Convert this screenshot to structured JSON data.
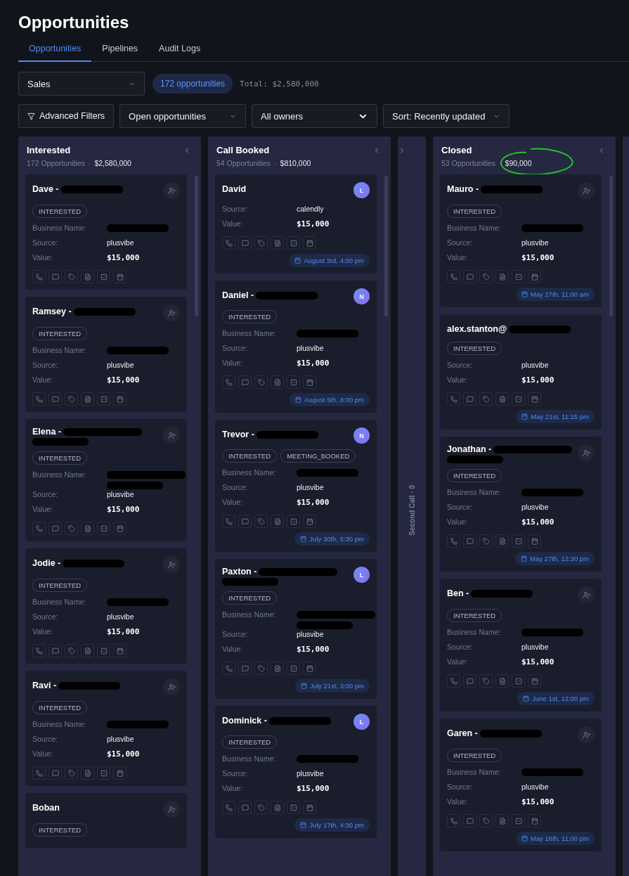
{
  "page": {
    "title": "Opportunities"
  },
  "tabs": [
    {
      "label": "Opportunities",
      "selected": true
    },
    {
      "label": "Pipelines",
      "selected": false
    },
    {
      "label": "Audit Logs",
      "selected": false
    }
  ],
  "toolbar": {
    "pipeline": "Sales",
    "count": "172 opportunities",
    "total": "Total: $2,580,000",
    "filters_button": "Advanced Filters",
    "status_filter": "Open opportunities",
    "owner_filter": "All owners",
    "sort": "Sort: Recently updated"
  },
  "columns": [
    {
      "kind": "expanded",
      "title": "Interested",
      "count": "172 Opportunities",
      "separator": "·",
      "value": "$2,580,000",
      "value_circled": false,
      "cards": [
        {
          "name": "Dave -",
          "redacted": true,
          "redaction_wraps": false,
          "owner": {
            "kind": "unassigned"
          },
          "tags": [
            "INTERESTED"
          ],
          "fields": [
            {
              "label": "Business Name:",
              "kind": "redacted",
              "wraps": false
            },
            {
              "label": "Source:",
              "kind": "text",
              "value": "plusvibe"
            },
            {
              "label": "Value:",
              "kind": "money",
              "value": "$15,000"
            }
          ]
        },
        {
          "name": "Ramsey -",
          "redacted": true,
          "redaction_wraps": false,
          "owner": {
            "kind": "unassigned"
          },
          "tags": [
            "INTERESTED"
          ],
          "fields": [
            {
              "label": "Business Name:",
              "kind": "redacted",
              "wraps": false
            },
            {
              "label": "Source:",
              "kind": "text",
              "value": "plusvibe"
            },
            {
              "label": "Value:",
              "kind": "money",
              "value": "$15,000"
            }
          ]
        },
        {
          "name": "Elena -",
          "redacted": true,
          "redaction_wraps": true,
          "owner": {
            "kind": "unassigned"
          },
          "tags": [
            "INTERESTED"
          ],
          "fields": [
            {
              "label": "Business Name:",
              "kind": "redacted",
              "wraps": true
            },
            {
              "label": "Source:",
              "kind": "text",
              "value": "plusvibe"
            },
            {
              "label": "Value:",
              "kind": "money",
              "value": "$15,000"
            }
          ]
        },
        {
          "name": "Jodie -",
          "redacted": true,
          "redaction_wraps": false,
          "owner": {
            "kind": "unassigned"
          },
          "tags": [
            "INTERESTED"
          ],
          "fields": [
            {
              "label": "Business Name:",
              "kind": "redacted",
              "wraps": false
            },
            {
              "label": "Source:",
              "kind": "text",
              "value": "plusvibe"
            },
            {
              "label": "Value:",
              "kind": "money",
              "value": "$15,000"
            }
          ]
        },
        {
          "name": "Ravi -",
          "redacted": true,
          "redaction_wraps": false,
          "owner": {
            "kind": "unassigned"
          },
          "tags": [
            "INTERESTED"
          ],
          "fields": [
            {
              "label": "Business Name:",
              "kind": "redacted",
              "wraps": false
            },
            {
              "label": "Source:",
              "kind": "text",
              "value": "plusvibe"
            },
            {
              "label": "Value:",
              "kind": "money",
              "value": "$15,000"
            }
          ]
        },
        {
          "name": "Boban",
          "redacted": false,
          "owner": {
            "kind": "unassigned"
          },
          "tags": [
            "INTERESTED"
          ]
        }
      ]
    },
    {
      "kind": "expanded",
      "title": "Call Booked",
      "count": "54 Opportunities",
      "separator": "·",
      "value": "$810,000",
      "value_circled": false,
      "cards": [
        {
          "name": "David",
          "redacted": false,
          "owner": {
            "kind": "avatar",
            "initial": "L"
          },
          "fields": [
            {
              "label": "Source:",
              "kind": "text",
              "value": "calendly"
            },
            {
              "label": "Value:",
              "kind": "money",
              "value": "$15,000"
            }
          ],
          "date": "August 3rd, 4:00 pm"
        },
        {
          "name": "Daniel -",
          "redacted": true,
          "redaction_wraps": false,
          "owner": {
            "kind": "avatar",
            "initial": "N"
          },
          "tags": [
            "INTERESTED"
          ],
          "fields": [
            {
              "label": "Business Name:",
              "kind": "redacted",
              "wraps": false
            },
            {
              "label": "Source:",
              "kind": "text",
              "value": "plusvibe"
            },
            {
              "label": "Value:",
              "kind": "money",
              "value": "$15,000"
            }
          ],
          "date": "August 5th, 8:00 pm"
        },
        {
          "name": "Trevor -",
          "redacted": true,
          "redaction_wraps": false,
          "owner": {
            "kind": "avatar",
            "initial": "N"
          },
          "tags": [
            "INTERESTED",
            "MEETING_BOOKED"
          ],
          "fields": [
            {
              "label": "Business Name:",
              "kind": "redacted",
              "wraps": false
            },
            {
              "label": "Source:",
              "kind": "text",
              "value": "plusvibe"
            },
            {
              "label": "Value:",
              "kind": "money",
              "value": "$15,000"
            }
          ],
          "date": "July 30th, 5:30 pm"
        },
        {
          "name": "Paxton -",
          "redacted": true,
          "redaction_wraps": true,
          "owner": {
            "kind": "avatar",
            "initial": "L"
          },
          "tags": [
            "INTERESTED"
          ],
          "fields": [
            {
              "label": "Business Name:",
              "kind": "redacted",
              "wraps": true
            },
            {
              "label": "Source:",
              "kind": "text",
              "value": "plusvibe"
            },
            {
              "label": "Value:",
              "kind": "money",
              "value": "$15,000"
            }
          ],
          "date": "July 21st, 3:00 pm"
        },
        {
          "name": "Dominick -",
          "redacted": true,
          "redaction_wraps": false,
          "owner": {
            "kind": "avatar",
            "initial": "L"
          },
          "tags": [
            "INTERESTED"
          ],
          "fields": [
            {
              "label": "Business Name:",
              "kind": "redacted",
              "wraps": false
            },
            {
              "label": "Source:",
              "kind": "text",
              "value": "plusvibe"
            },
            {
              "label": "Value:",
              "kind": "money",
              "value": "$15,000"
            }
          ],
          "date": "July 17th, 4:30 pm"
        }
      ]
    },
    {
      "kind": "collapsed",
      "title": "Second Call · 0"
    },
    {
      "kind": "expanded",
      "title": "Closed",
      "count": "53 Opportunities",
      "separator": "·",
      "value": "$90,000",
      "value_circled": true,
      "cards": [
        {
          "name": "Mauro -",
          "redacted": true,
          "redaction_wraps": false,
          "owner": {
            "kind": "unassigned"
          },
          "tags": [
            "INTERESTED"
          ],
          "fields": [
            {
              "label": "Business Name:",
              "kind": "redacted",
              "wraps": false
            },
            {
              "label": "Source:",
              "kind": "text",
              "value": "plusvibe"
            },
            {
              "label": "Value:",
              "kind": "money",
              "value": "$15,000"
            }
          ],
          "date": "May 27th, 11:00 am"
        },
        {
          "name": "alex.stanton@",
          "redacted": true,
          "redaction_wraps": false,
          "owner": {
            "kind": "none"
          },
          "tags": [
            "INTERESTED"
          ],
          "fields": [
            {
              "label": "Source:",
              "kind": "text",
              "value": "plusvibe"
            },
            {
              "label": "Value:",
              "kind": "money",
              "value": "$15,000"
            }
          ],
          "date": "May 21st, 11:15 pm"
        },
        {
          "name": "Jonathan -",
          "redacted": true,
          "redaction_wraps": true,
          "owner": {
            "kind": "unassigned"
          },
          "tags": [
            "INTERESTED"
          ],
          "fields": [
            {
              "label": "Business Name:",
              "kind": "redacted",
              "wraps": false
            },
            {
              "label": "Source:",
              "kind": "text",
              "value": "plusvibe"
            },
            {
              "label": "Value:",
              "kind": "money",
              "value": "$15,000"
            }
          ],
          "date": "May 27th, 12:30 pm"
        },
        {
          "name": "Ben -",
          "redacted": true,
          "redaction_wraps": false,
          "owner": {
            "kind": "unassigned"
          },
          "tags": [
            "INTERESTED"
          ],
          "fields": [
            {
              "label": "Business Name:",
              "kind": "redacted",
              "wraps": false
            },
            {
              "label": "Source:",
              "kind": "text",
              "value": "plusvibe"
            },
            {
              "label": "Value:",
              "kind": "money",
              "value": "$15,000"
            }
          ],
          "date": "June 1st, 12:00 pm"
        },
        {
          "name": "Garen -",
          "redacted": true,
          "redaction_wraps": false,
          "owner": {
            "kind": "unassigned"
          },
          "tags": [
            "INTERESTED"
          ],
          "fields": [
            {
              "label": "Business Name:",
              "kind": "redacted",
              "wraps": false
            },
            {
              "label": "Source:",
              "kind": "text",
              "value": "plusvibe"
            },
            {
              "label": "Value:",
              "kind": "money",
              "value": "$15,000"
            }
          ],
          "date": "May 18th, 11:00 pm"
        }
      ]
    }
  ]
}
